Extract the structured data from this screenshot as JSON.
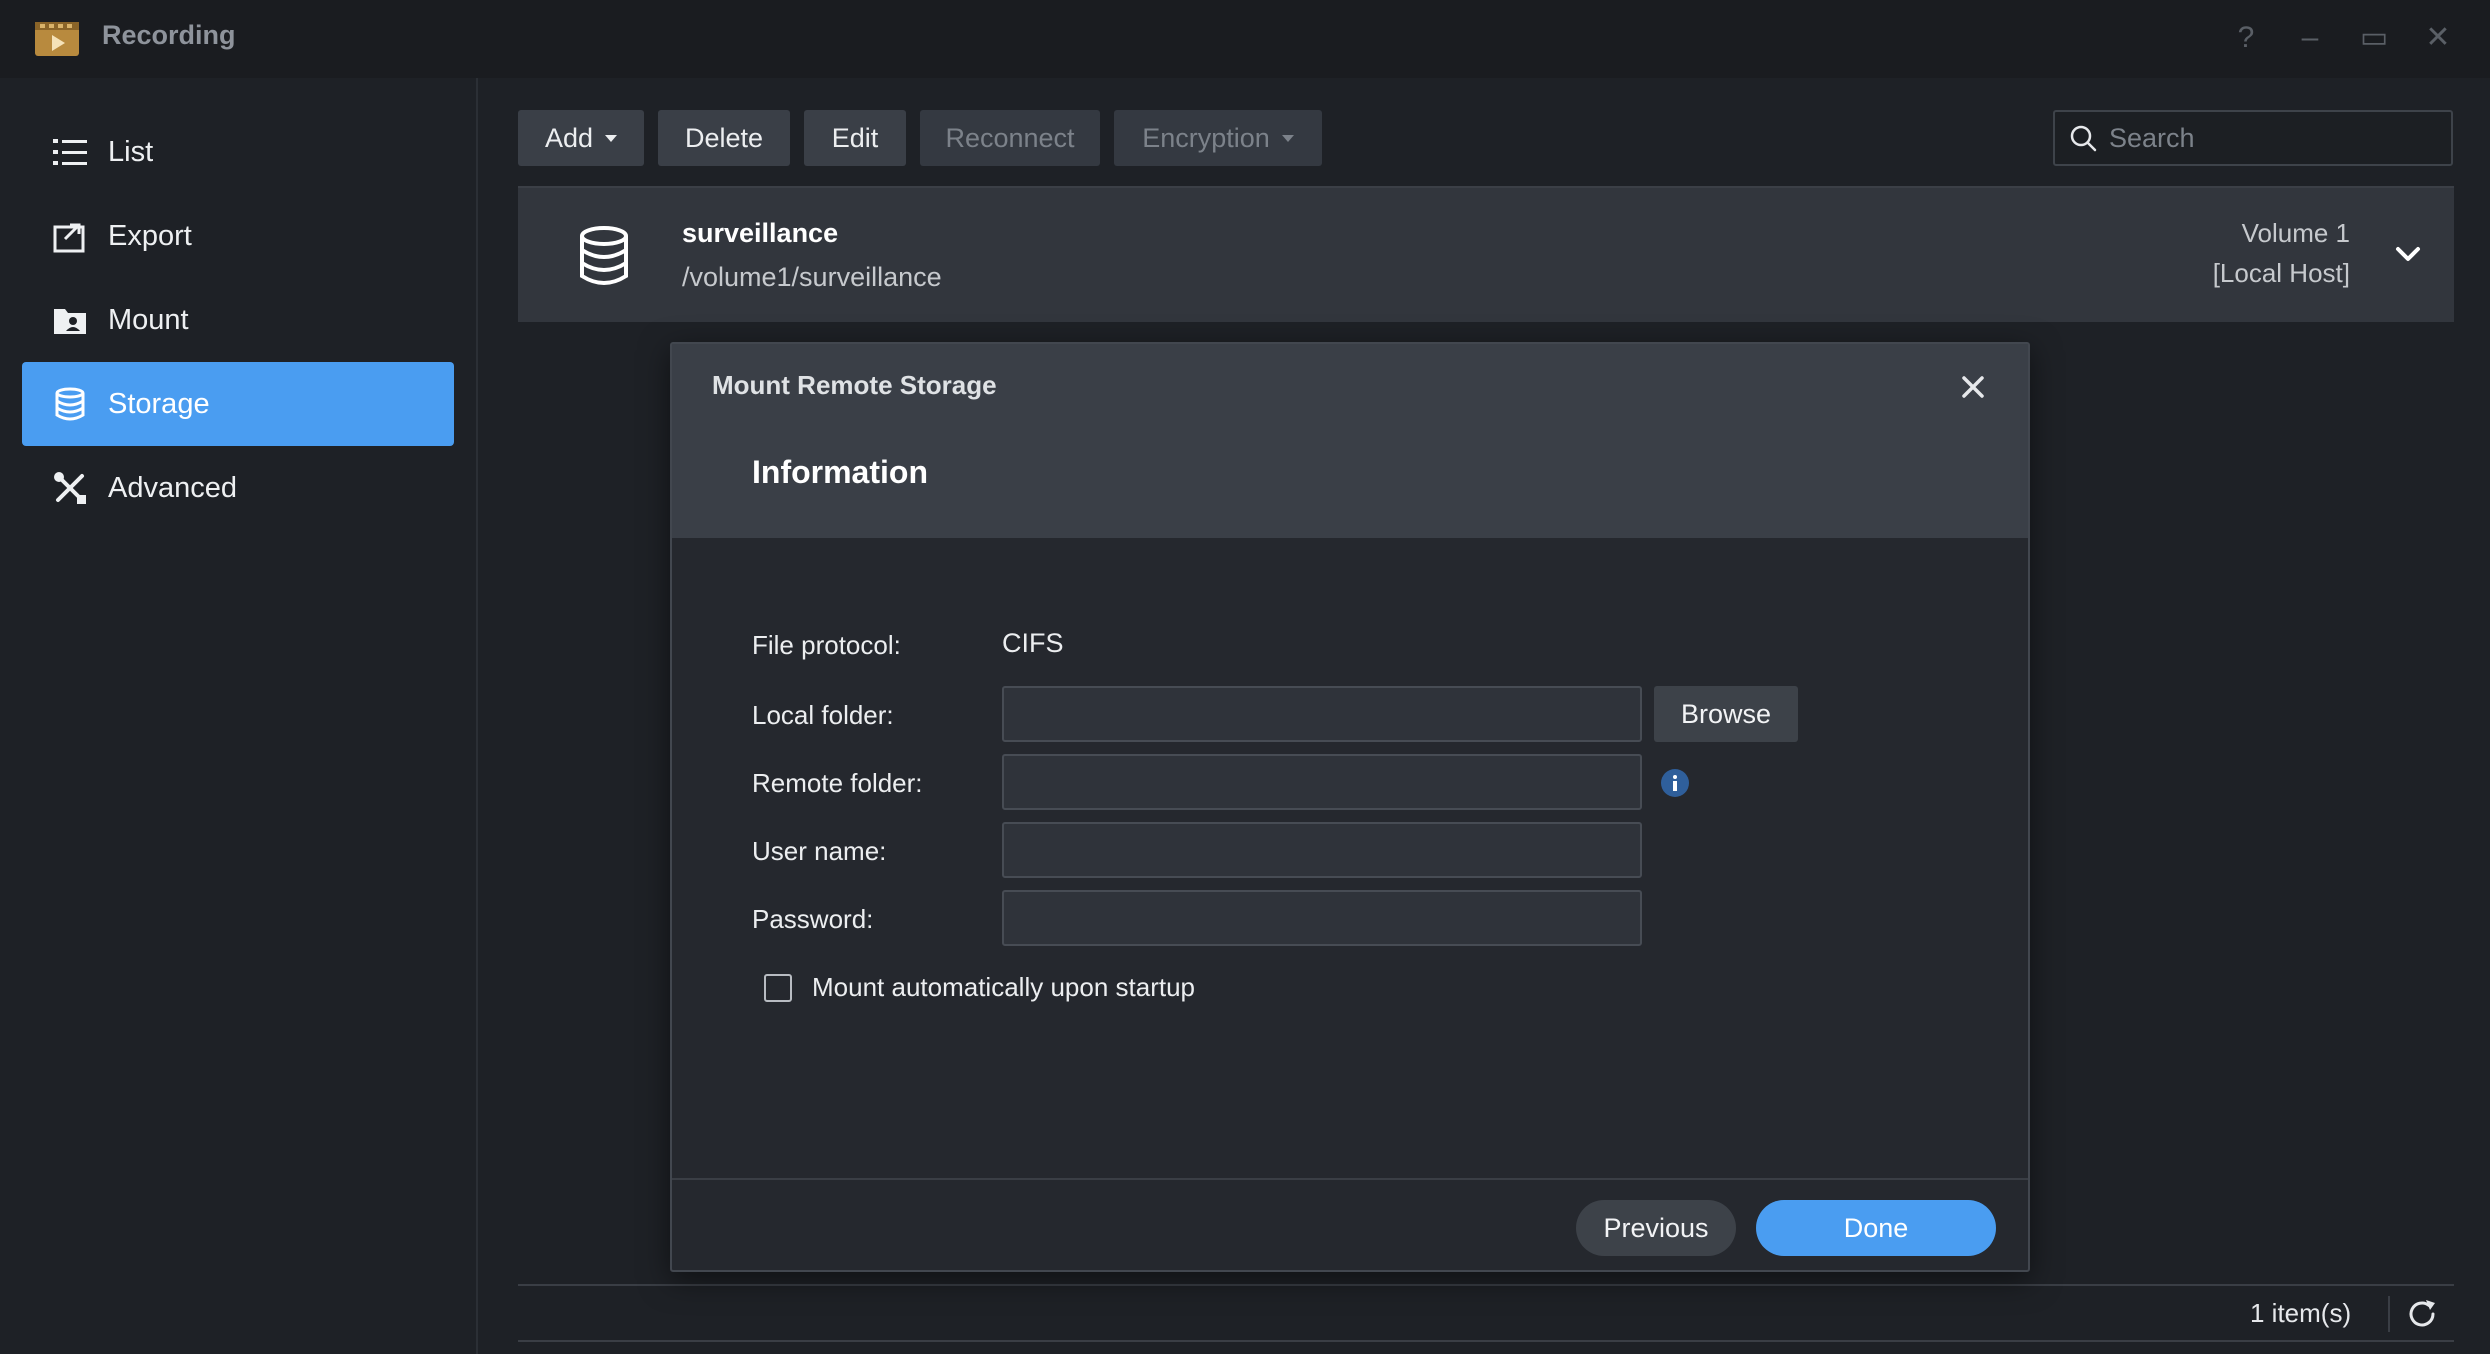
{
  "window": {
    "title": "Recording",
    "controls": [
      "?",
      "–",
      "▭",
      "✕"
    ]
  },
  "sidebar": {
    "items": [
      {
        "label": "List",
        "icon": "list-icon"
      },
      {
        "label": "Export",
        "icon": "export-icon"
      },
      {
        "label": "Mount",
        "icon": "mount-icon"
      },
      {
        "label": "Storage",
        "icon": "storage-icon",
        "active": true
      },
      {
        "label": "Advanced",
        "icon": "advanced-tools-icon"
      }
    ]
  },
  "toolbar": {
    "add_label": "Add",
    "delete_label": "Delete",
    "edit_label": "Edit",
    "reconnect_label": "Reconnect",
    "encryption_label": "Encryption",
    "search_placeholder": "Search"
  },
  "storage_list": {
    "rows": [
      {
        "name": "surveillance",
        "path": "/volume1/surveillance",
        "volume": "Volume 1",
        "host": "[Local Host]"
      }
    ],
    "count_label": "1 item(s)"
  },
  "dialog": {
    "title": "Mount Remote Storage",
    "section": "Information",
    "fields": {
      "protocol_label": "File protocol:",
      "protocol_value": "CIFS",
      "local_folder_label": "Local folder:",
      "local_folder_value": "",
      "remote_folder_label": "Remote folder:",
      "remote_folder_value": "",
      "username_label": "User name:",
      "username_value": "",
      "password_label": "Password:",
      "password_value": ""
    },
    "browse_label": "Browse",
    "auto_mount_label": "Mount automatically upon startup",
    "auto_mount_checked": false,
    "previous_label": "Previous",
    "done_label": "Done"
  },
  "colors": {
    "accent": "#4a9df1",
    "background": "#1e2126",
    "panel": "#32363d"
  }
}
